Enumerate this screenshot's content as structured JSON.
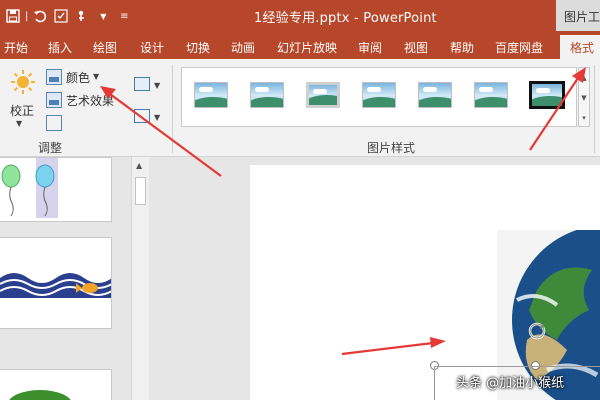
{
  "window": {
    "title": "1经验专用.pptx - PowerPoint",
    "context_tab_group": "图片工具"
  },
  "quick_access": {
    "icons": [
      "save-icon",
      "undo-icon",
      "touch-mode-icon",
      "customize-icon"
    ]
  },
  "tabs": [
    {
      "label": "开始",
      "active": false
    },
    {
      "label": "插入",
      "active": false
    },
    {
      "label": "绘图",
      "active": false
    },
    {
      "label": "设计",
      "active": false
    },
    {
      "label": "切换",
      "active": false
    },
    {
      "label": "动画",
      "active": false
    },
    {
      "label": "幻灯片放映",
      "active": false
    },
    {
      "label": "审阅",
      "active": false
    },
    {
      "label": "视图",
      "active": false
    },
    {
      "label": "帮助",
      "active": false
    },
    {
      "label": "百度网盘",
      "active": false
    },
    {
      "label": "格式",
      "active": true
    }
  ],
  "ribbon": {
    "adjust_group": {
      "label": "调整",
      "corrections_label": "校正",
      "color_label": "颜色",
      "artistic_effects_label": "艺术效果"
    },
    "picture_styles_group": {
      "label": "图片样式",
      "style_count": 7,
      "selected_index": 6
    }
  },
  "watermark": {
    "text": "头条 @加油小猴纸"
  },
  "colors": {
    "title_bar": "#b7472a",
    "ribbon_bg": "#f2f2f2",
    "annotation_arrow": "#e53935",
    "active_tab_text": "#b7472a"
  }
}
